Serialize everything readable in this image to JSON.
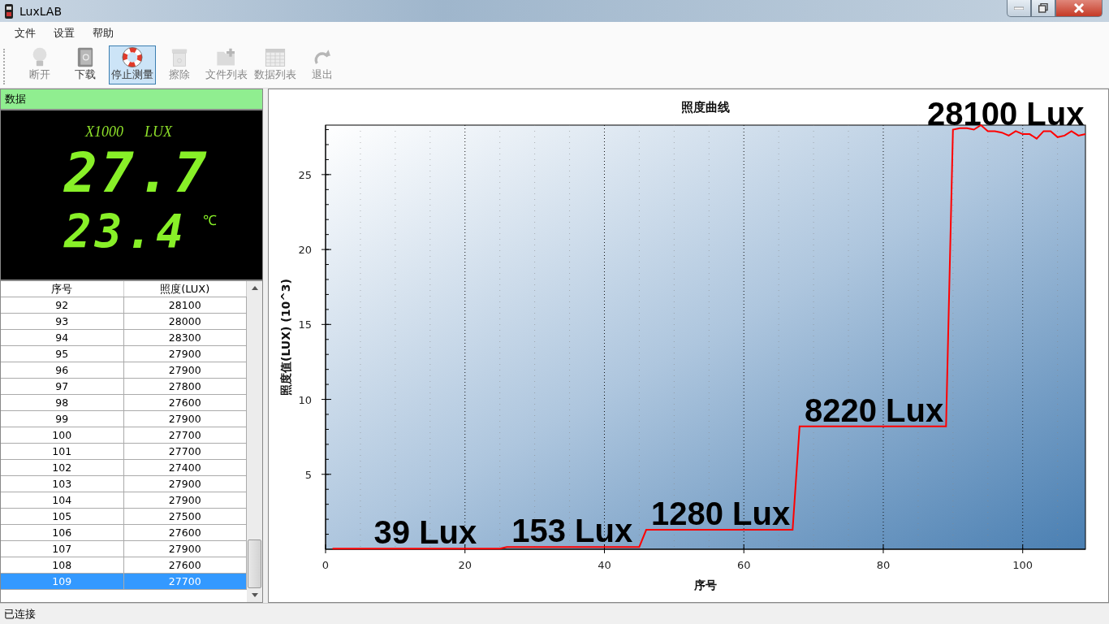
{
  "window": {
    "title": "LuxLAB"
  },
  "menu": [
    "文件",
    "设置",
    "帮助"
  ],
  "toolbar": [
    {
      "label": "断开",
      "kind": "bulb",
      "disabled": true,
      "selected": false
    },
    {
      "label": "下载",
      "kind": "book",
      "disabled": false,
      "selected": false
    },
    {
      "label": "停止测量",
      "kind": "lifebuoy",
      "disabled": false,
      "selected": true
    },
    {
      "label": "擦除",
      "kind": "bin",
      "disabled": true,
      "selected": false
    },
    {
      "label": "文件列表",
      "kind": "folder",
      "disabled": true,
      "selected": false
    },
    {
      "label": "数据列表",
      "kind": "grid",
      "disabled": true,
      "selected": false
    },
    {
      "label": "退出",
      "kind": "redo",
      "disabled": true,
      "selected": false
    }
  ],
  "data_panel": {
    "title": "数据",
    "display": {
      "scale": "X1000",
      "unit": "LUX",
      "reading": "27.7",
      "temperature": "23.4",
      "temperature_unit": "℃"
    }
  },
  "table": {
    "columns": [
      "序号",
      "照度(LUX)"
    ],
    "rows": [
      {
        "cells": [
          "92",
          "28100"
        ],
        "selected": false
      },
      {
        "cells": [
          "93",
          "28000"
        ],
        "selected": false
      },
      {
        "cells": [
          "94",
          "28300"
        ],
        "selected": false
      },
      {
        "cells": [
          "95",
          "27900"
        ],
        "selected": false
      },
      {
        "cells": [
          "96",
          "27900"
        ],
        "selected": false
      },
      {
        "cells": [
          "97",
          "27800"
        ],
        "selected": false
      },
      {
        "cells": [
          "98",
          "27600"
        ],
        "selected": false
      },
      {
        "cells": [
          "99",
          "27900"
        ],
        "selected": false
      },
      {
        "cells": [
          "100",
          "27700"
        ],
        "selected": false
      },
      {
        "cells": [
          "101",
          "27700"
        ],
        "selected": false
      },
      {
        "cells": [
          "102",
          "27400"
        ],
        "selected": false
      },
      {
        "cells": [
          "103",
          "27900"
        ],
        "selected": false
      },
      {
        "cells": [
          "104",
          "27900"
        ],
        "selected": false
      },
      {
        "cells": [
          "105",
          "27500"
        ],
        "selected": false
      },
      {
        "cells": [
          "106",
          "27600"
        ],
        "selected": false
      },
      {
        "cells": [
          "107",
          "27900"
        ],
        "selected": false
      },
      {
        "cells": [
          "108",
          "27600"
        ],
        "selected": false
      },
      {
        "cells": [
          "109",
          "27700"
        ],
        "selected": true
      }
    ]
  },
  "chart": {
    "chart_data": {
      "type": "line",
      "title": "照度曲线",
      "xlabel": "序号",
      "ylabel": "照度值(LUX) (10^3)",
      "x": [
        1,
        25,
        26,
        45,
        46,
        67,
        68,
        86,
        87,
        89,
        90,
        91,
        92,
        93,
        94,
        95,
        96,
        97,
        98,
        99,
        100,
        101,
        102,
        103,
        104,
        105,
        106,
        107,
        108,
        109
      ],
      "series": [
        {
          "color": "#ff0000",
          "values": [
            0.04,
            0.04,
            0.15,
            0.15,
            1.3,
            1.3,
            8.2,
            8.2,
            8.2,
            8.2,
            28.0,
            28.1,
            28.1,
            28.0,
            28.3,
            27.9,
            27.9,
            27.8,
            27.6,
            27.9,
            27.7,
            27.7,
            27.4,
            27.9,
            27.9,
            27.5,
            27.6,
            27.9,
            27.6,
            27.7
          ]
        }
      ],
      "xlim": [
        0,
        109
      ],
      "ylim": [
        0,
        28.3
      ],
      "grid": true,
      "xticks": [
        0,
        20,
        40,
        60,
        80,
        100
      ],
      "yticks": [
        5,
        10,
        15,
        20,
        25
      ],
      "annotations": [
        "39 Lux",
        "153 Lux",
        "1280 Lux",
        "8220 Lux",
        "28100 Lux"
      ]
    }
  },
  "status_bar": "已连接"
}
